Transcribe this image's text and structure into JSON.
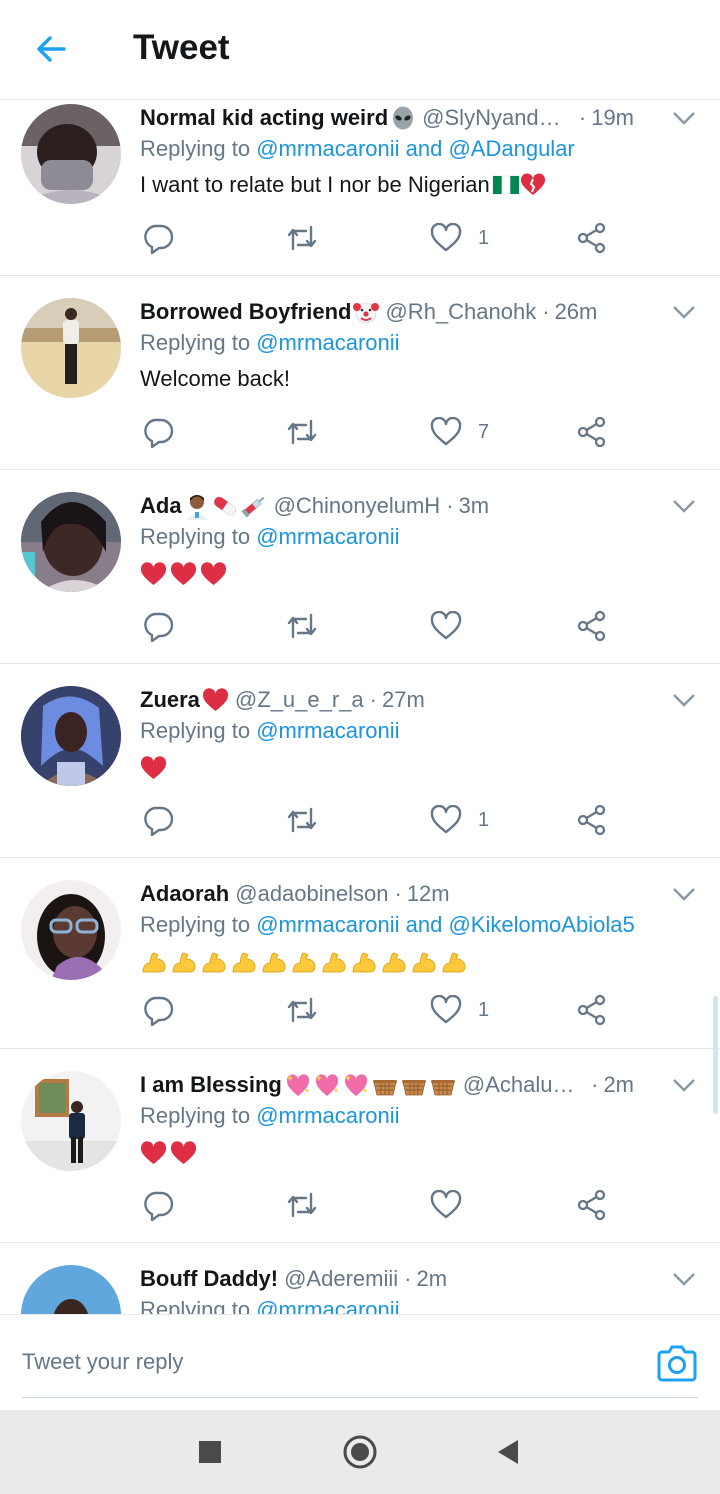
{
  "header": {
    "title": "Tweet",
    "back_icon": "arrow-left-icon",
    "accent": "#1da1f2"
  },
  "feed": {
    "tweets": [
      {
        "name": "Normal kid acting weird",
        "name_emoji": [
          "alien"
        ],
        "handle": "@SlyNyande…",
        "time": "19m",
        "reply_prefix": "Replying to ",
        "reply_to": "@mrmacaronii and @ADangular",
        "text": "I want to relate but I nor be Nigerian",
        "text_emoji": [
          "flag-ng",
          "broken-heart"
        ],
        "likes": "1"
      },
      {
        "name": "Borrowed Boyfriend",
        "name_emoji": [
          "clown"
        ],
        "handle": "@Rh_Chanohk",
        "time": "26m",
        "reply_prefix": "Replying to ",
        "reply_to": "@mrmacaronii",
        "text": "Welcome back!",
        "text_emoji": [],
        "likes": "7"
      },
      {
        "name": "Ada",
        "name_emoji": [
          "health-worker",
          "pill",
          "syringe"
        ],
        "handle": "@ChinonyelumH",
        "time": "3m",
        "reply_prefix": "Replying to ",
        "reply_to": "@mrmacaronii",
        "text": "",
        "text_emoji": [
          "red-heart",
          "red-heart",
          "red-heart"
        ],
        "likes": ""
      },
      {
        "name": "Zuera",
        "name_emoji": [
          "red-heart"
        ],
        "handle": "@Z_u_e_r_a",
        "time": "27m",
        "reply_prefix": "Replying to ",
        "reply_to": "@mrmacaronii",
        "text": "",
        "text_emoji": [
          "red-heart"
        ],
        "likes": "1"
      },
      {
        "name": "Adaorah",
        "name_emoji": [],
        "handle": "@adaobinelson",
        "time": "12m",
        "reply_prefix": "Replying to ",
        "reply_to": "@mrmacaronii and @KikelomoAbiola5",
        "text": "",
        "text_emoji": [
          "flexed-biceps",
          "flexed-biceps",
          "flexed-biceps",
          "flexed-biceps",
          "flexed-biceps",
          "flexed-biceps",
          "flexed-biceps",
          "flexed-biceps",
          "flexed-biceps",
          "flexed-biceps",
          "flexed-biceps"
        ],
        "likes": "1"
      },
      {
        "name": "I am Blessing",
        "name_emoji": [
          "sparkling-heart",
          "sparkling-heart",
          "sparkling-heart",
          "basket",
          "basket",
          "basket"
        ],
        "handle": "@AchalugoB",
        "time": "2m",
        "reply_prefix": "Replying to ",
        "reply_to": "@mrmacaronii",
        "text": "",
        "text_emoji": [
          "red-heart",
          "red-heart"
        ],
        "likes": ""
      },
      {
        "name": "Bouff Daddy!",
        "name_emoji": [],
        "handle": "@Aderemiii",
        "time": "2m",
        "reply_prefix": "Replying to ",
        "reply_to": "@mrmacaronii",
        "text": "",
        "text_emoji": [],
        "likes": ""
      }
    ]
  },
  "composer": {
    "placeholder": "Tweet your reply",
    "camera_icon": "camera-icon"
  },
  "navbar": {
    "items": [
      "recents-square-icon",
      "home-circle-icon",
      "back-triangle-icon"
    ]
  },
  "colors": {
    "link": "#1b95e0",
    "muted": "#657786",
    "heart_red": "#dd2e44"
  }
}
